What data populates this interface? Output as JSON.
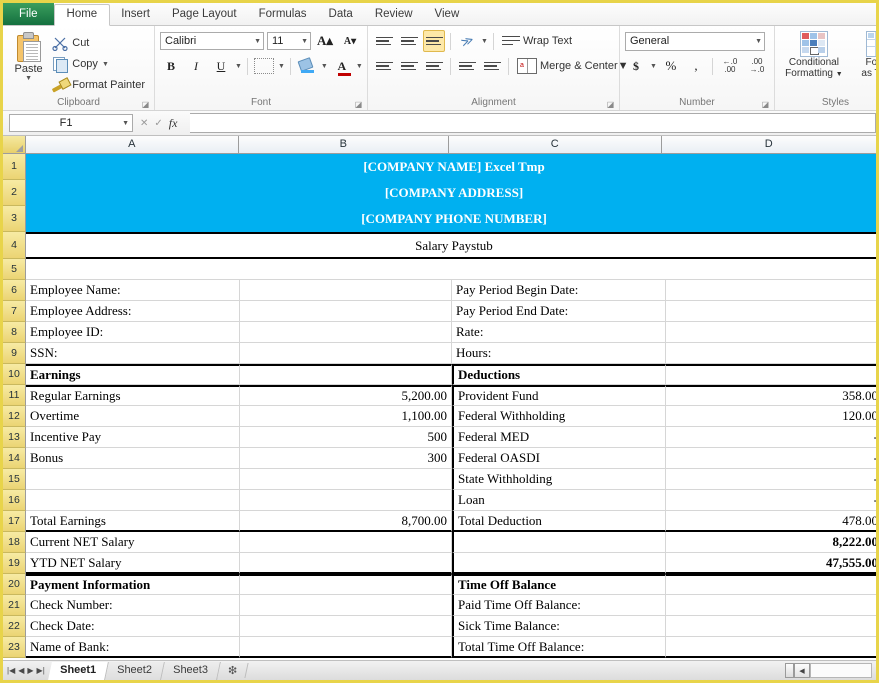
{
  "ribbon": {
    "tabs": [
      {
        "label": "File",
        "name": "tab-file"
      },
      {
        "label": "Home",
        "name": "tab-home"
      },
      {
        "label": "Insert",
        "name": "tab-insert"
      },
      {
        "label": "Page Layout",
        "name": "tab-page-layout"
      },
      {
        "label": "Formulas",
        "name": "tab-formulas"
      },
      {
        "label": "Data",
        "name": "tab-data"
      },
      {
        "label": "Review",
        "name": "tab-review"
      },
      {
        "label": "View",
        "name": "tab-view"
      }
    ],
    "clipboard": {
      "group_title": "Clipboard",
      "paste": "Paste",
      "cut": "Cut",
      "copy": "Copy",
      "format_painter": "Format Painter"
    },
    "font": {
      "group_title": "Font",
      "font_name": "Calibri",
      "font_size": "11",
      "bold": "B",
      "italic": "I",
      "underline": "U"
    },
    "alignment": {
      "group_title": "Alignment",
      "wrap_text": "Wrap Text",
      "merge_center": "Merge & Center"
    },
    "number": {
      "group_title": "Number",
      "format": "General",
      "currency": "$",
      "percent": "%",
      "comma": ","
    },
    "styles": {
      "group_title": "Styles",
      "conditional_formatting": "Conditional\nFormatting",
      "conditional_formatting_l1": "Conditional",
      "conditional_formatting_l2": "Formatting",
      "format_as_table_l1": "Forma",
      "format_as_table_l2": "as Table"
    }
  },
  "formula_bar": {
    "name_box": "F1",
    "fx_label": "fx",
    "formula_value": ""
  },
  "grid": {
    "columns": [
      "A",
      "B",
      "C",
      "D"
    ],
    "rows": [
      {
        "n": "1",
        "cells": [
          {
            "t": "[COMPANY NAME] Excel Tmp",
            "span": 4,
            "cls": "blue"
          }
        ]
      },
      {
        "n": "2",
        "cells": [
          {
            "t": "[COMPANY ADDRESS]",
            "span": 4,
            "cls": "blue"
          }
        ]
      },
      {
        "n": "3",
        "cells": [
          {
            "t": "[COMPANY PHONE NUMBER]",
            "span": 4,
            "cls": "blue"
          }
        ]
      },
      {
        "n": "4",
        "cells": [
          {
            "t": "Salary Paystub",
            "span": 4,
            "cls": "center"
          }
        ]
      },
      {
        "n": "5",
        "cells": [
          {
            "t": "",
            "span": 4,
            "cls": ""
          }
        ]
      },
      {
        "n": "6",
        "cells": [
          {
            "t": "Employee Name:"
          },
          {
            "t": ""
          },
          {
            "t": "Pay Period Begin Date:"
          },
          {
            "t": ""
          }
        ]
      },
      {
        "n": "7",
        "cells": [
          {
            "t": "Employee Address:"
          },
          {
            "t": ""
          },
          {
            "t": "Pay Period End Date:"
          },
          {
            "t": ""
          }
        ]
      },
      {
        "n": "8",
        "cells": [
          {
            "t": "Employee ID:"
          },
          {
            "t": ""
          },
          {
            "t": "Rate:"
          },
          {
            "t": ""
          }
        ]
      },
      {
        "n": "9",
        "cells": [
          {
            "t": "SSN:"
          },
          {
            "t": ""
          },
          {
            "t": "Hours:"
          },
          {
            "t": ""
          }
        ]
      },
      {
        "n": "10",
        "cells": [
          {
            "t": "Earnings",
            "cls": "b"
          },
          {
            "t": ""
          },
          {
            "t": "Deductions",
            "cls": "b"
          },
          {
            "t": ""
          }
        ]
      },
      {
        "n": "11",
        "cells": [
          {
            "t": "Regular Earnings"
          },
          {
            "t": "5,200.00",
            "cls": "right"
          },
          {
            "t": "Provident Fund"
          },
          {
            "t": "358.00",
            "cls": "right"
          }
        ]
      },
      {
        "n": "12",
        "cells": [
          {
            "t": "Overtime"
          },
          {
            "t": "1,100.00",
            "cls": "right"
          },
          {
            "t": "Federal Withholding"
          },
          {
            "t": "120.00",
            "cls": "right"
          }
        ]
      },
      {
        "n": "13",
        "cells": [
          {
            "t": "Incentive Pay"
          },
          {
            "t": "500",
            "cls": "right"
          },
          {
            "t": "Federal MED"
          },
          {
            "t": "-",
            "cls": "right"
          }
        ]
      },
      {
        "n": "14",
        "cells": [
          {
            "t": "Bonus"
          },
          {
            "t": "300",
            "cls": "right"
          },
          {
            "t": "Federal OASDI"
          },
          {
            "t": "-",
            "cls": "right"
          }
        ]
      },
      {
        "n": "15",
        "cells": [
          {
            "t": ""
          },
          {
            "t": ""
          },
          {
            "t": "State Withholding"
          },
          {
            "t": "-",
            "cls": "right"
          }
        ]
      },
      {
        "n": "16",
        "cells": [
          {
            "t": ""
          },
          {
            "t": ""
          },
          {
            "t": "Loan"
          },
          {
            "t": "-",
            "cls": "right"
          }
        ]
      },
      {
        "n": "17",
        "cells": [
          {
            "t": "Total Earnings"
          },
          {
            "t": "8,700.00",
            "cls": "right"
          },
          {
            "t": "Total Deduction"
          },
          {
            "t": "478.00",
            "cls": "right"
          }
        ]
      },
      {
        "n": "18",
        "cells": [
          {
            "t": "Current NET Salary"
          },
          {
            "t": ""
          },
          {
            "t": ""
          },
          {
            "t": "8,222.00",
            "cls": "right b"
          }
        ]
      },
      {
        "n": "19",
        "cells": [
          {
            "t": "YTD NET Salary"
          },
          {
            "t": ""
          },
          {
            "t": ""
          },
          {
            "t": "47,555.00",
            "cls": "right b"
          }
        ]
      },
      {
        "n": "20",
        "cells": [
          {
            "t": "Payment Information",
            "cls": "b"
          },
          {
            "t": ""
          },
          {
            "t": "Time Off Balance",
            "cls": "b"
          },
          {
            "t": ""
          }
        ]
      },
      {
        "n": "21",
        "cells": [
          {
            "t": "Check  Number:"
          },
          {
            "t": ""
          },
          {
            "t": "Paid Time Off Balance:"
          },
          {
            "t": ""
          }
        ]
      },
      {
        "n": "22",
        "cells": [
          {
            "t": "Check Date:"
          },
          {
            "t": ""
          },
          {
            "t": "Sick Time Balance:"
          },
          {
            "t": ""
          }
        ]
      },
      {
        "n": "23",
        "cells": [
          {
            "t": "Name of Bank:"
          },
          {
            "t": ""
          },
          {
            "t": "Total Time Off Balance:"
          },
          {
            "t": ""
          }
        ]
      }
    ]
  },
  "sheet_tabs": {
    "tabs": [
      "Sheet1",
      "Sheet2",
      "Sheet3"
    ],
    "active": "Sheet1",
    "new_sheet_label": "➕"
  },
  "colors": {
    "header_blue": "#00B0F0",
    "file_tab_green": "#1E7145",
    "window_border": "#E8D44A"
  }
}
